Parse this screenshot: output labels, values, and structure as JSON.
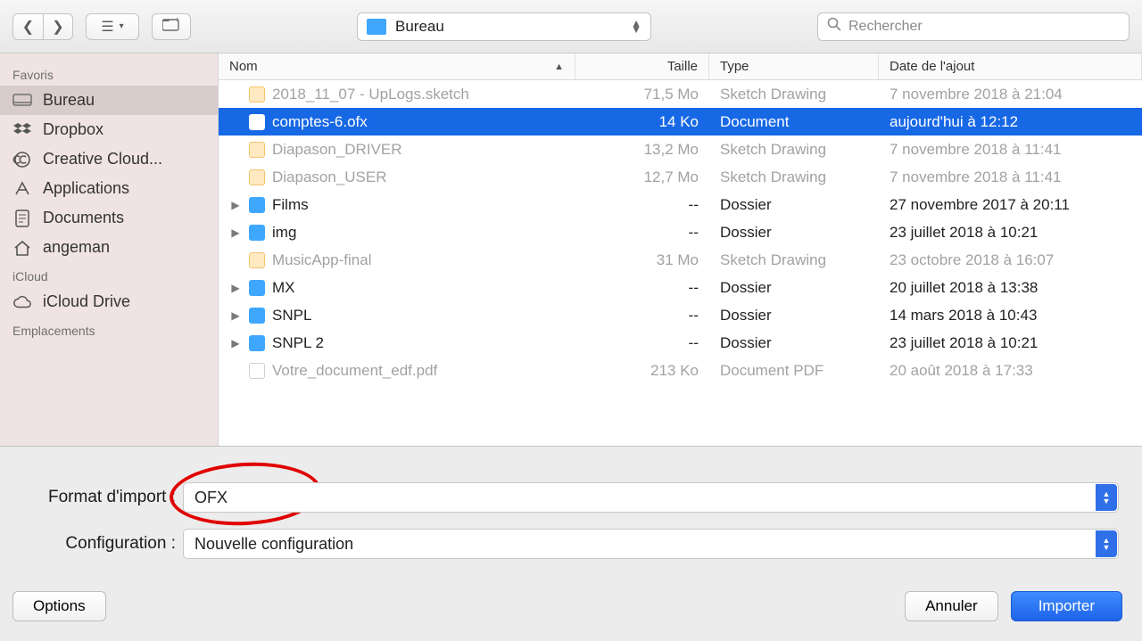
{
  "toolbar": {
    "path_label": "Bureau",
    "search_placeholder": "Rechercher"
  },
  "sidebar": {
    "sections": [
      {
        "title": "Favoris",
        "items": [
          {
            "icon": "desktop",
            "label": "Bureau",
            "selected": true
          },
          {
            "icon": "dropbox",
            "label": "Dropbox"
          },
          {
            "icon": "cc",
            "label": "Creative Cloud..."
          },
          {
            "icon": "apps",
            "label": "Applications"
          },
          {
            "icon": "docs",
            "label": "Documents"
          },
          {
            "icon": "home",
            "label": "angeman"
          }
        ]
      },
      {
        "title": "iCloud",
        "items": [
          {
            "icon": "cloud",
            "label": "iCloud Drive"
          }
        ]
      },
      {
        "title": "Emplacements",
        "items": []
      }
    ]
  },
  "columns": {
    "name": "Nom",
    "size": "Taille",
    "type": "Type",
    "date": "Date de l'ajout"
  },
  "rows": [
    {
      "kind": "sketch",
      "dim": true,
      "name": "2018_11_07 - UpLogs.sketch",
      "size": "71,5 Mo",
      "type": "Sketch Drawing",
      "date": "7 novembre 2018 à 21:04"
    },
    {
      "kind": "doc",
      "selected": true,
      "name": "comptes-6.ofx",
      "size": "14 Ko",
      "type": "Document",
      "date": "aujourd'hui à 12:12"
    },
    {
      "kind": "sketch",
      "dim": true,
      "name": "Diapason_DRIVER",
      "size": "13,2 Mo",
      "type": "Sketch Drawing",
      "date": "7 novembre 2018 à 11:41"
    },
    {
      "kind": "sketch",
      "dim": true,
      "name": "Diapason_USER",
      "size": "12,7 Mo",
      "type": "Sketch Drawing",
      "date": "7 novembre 2018 à 11:41"
    },
    {
      "kind": "folder",
      "expand": true,
      "name": "Films",
      "size": "--",
      "type": "Dossier",
      "date": "27 novembre 2017 à 20:11"
    },
    {
      "kind": "folder",
      "expand": true,
      "name": "img",
      "size": "--",
      "type": "Dossier",
      "date": "23 juillet 2018 à 10:21"
    },
    {
      "kind": "sketch",
      "dim": true,
      "name": "MusicApp-final",
      "size": "31 Mo",
      "type": "Sketch Drawing",
      "date": "23 octobre 2018 à 16:07"
    },
    {
      "kind": "folder",
      "expand": true,
      "name": "MX",
      "size": "--",
      "type": "Dossier",
      "date": "20 juillet 2018 à 13:38"
    },
    {
      "kind": "folder",
      "expand": true,
      "name": "SNPL",
      "size": "--",
      "type": "Dossier",
      "date": "14 mars 2018 à 10:43"
    },
    {
      "kind": "folder",
      "expand": true,
      "name": "SNPL 2",
      "size": "--",
      "type": "Dossier",
      "date": "23 juillet 2018 à 10:21"
    },
    {
      "kind": "pdf",
      "dim": true,
      "name": "Votre_document_edf.pdf",
      "size": "213 Ko",
      "type": "Document PDF",
      "date": "20 août 2018 à 17:33"
    }
  ],
  "form": {
    "format_label": "Format d'import :",
    "format_value": "OFX",
    "config_label": "Configuration :",
    "config_value": "Nouvelle configuration"
  },
  "buttons": {
    "options": "Options",
    "cancel": "Annuler",
    "import": "Importer"
  }
}
